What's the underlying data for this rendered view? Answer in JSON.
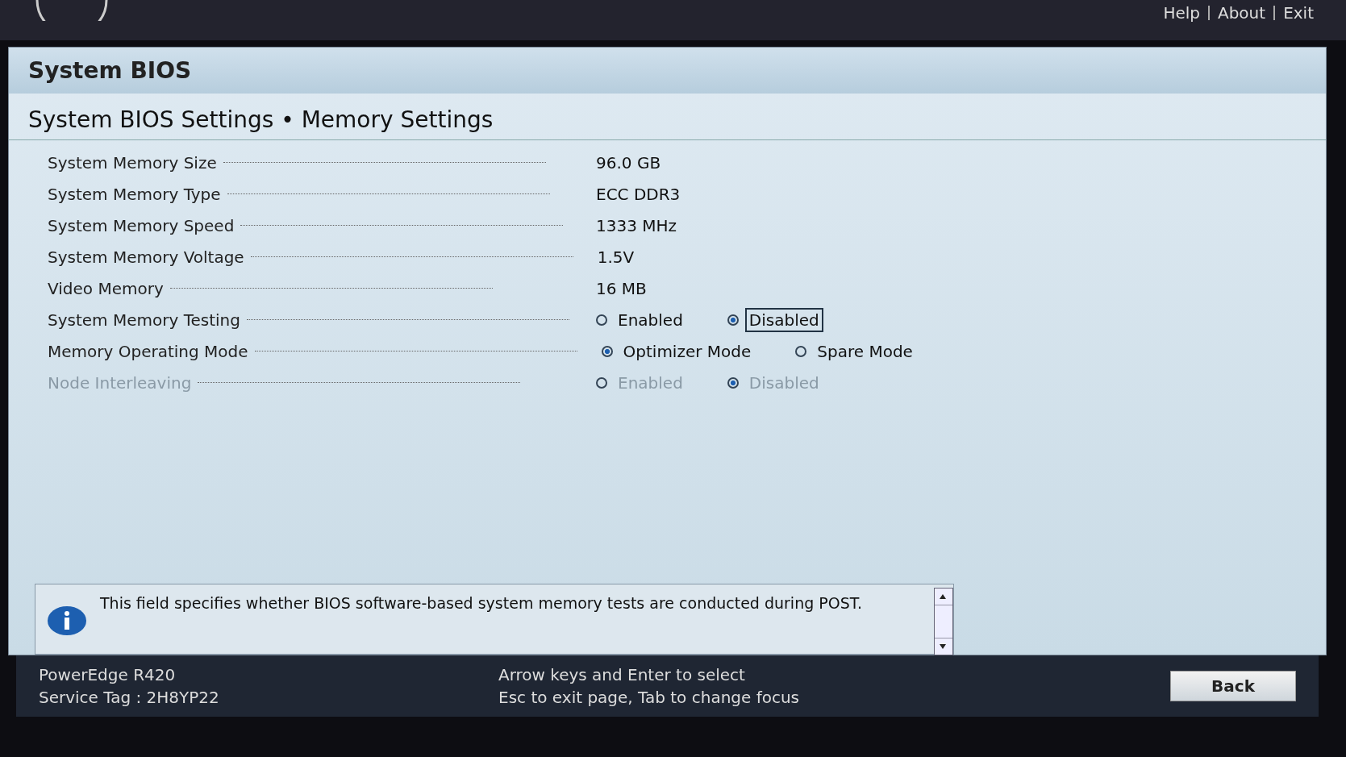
{
  "header": {
    "links": [
      "Help",
      "About",
      "Exit"
    ]
  },
  "title": "System BIOS",
  "subtitle": "System BIOS Settings • Memory Settings",
  "settings": [
    {
      "kind": "value",
      "label": "System Memory Size",
      "disabled": false,
      "value": "96.0 GB"
    },
    {
      "kind": "value",
      "label": "System Memory Type",
      "disabled": false,
      "value": "ECC DDR3"
    },
    {
      "kind": "value",
      "label": "System Memory Speed",
      "disabled": false,
      "value": "1333 MHz"
    },
    {
      "kind": "value",
      "label": "System Memory Voltage",
      "disabled": false,
      "value": "1.5V"
    },
    {
      "kind": "value",
      "label": "Video Memory",
      "disabled": false,
      "value": "16 MB"
    },
    {
      "kind": "radio",
      "label": "System Memory Testing",
      "disabled": false,
      "options": [
        {
          "label": "Enabled",
          "selected": false,
          "focused": false
        },
        {
          "label": "Disabled",
          "selected": true,
          "focused": true
        }
      ]
    },
    {
      "kind": "radio",
      "label": "Memory Operating Mode",
      "disabled": false,
      "options": [
        {
          "label": "Optimizer Mode",
          "selected": true,
          "focused": false
        },
        {
          "label": "Spare Mode",
          "selected": false,
          "focused": false
        }
      ]
    },
    {
      "kind": "radio",
      "label": "Node Interleaving",
      "disabled": true,
      "options": [
        {
          "label": "Enabled",
          "selected": false,
          "focused": false
        },
        {
          "label": "Disabled",
          "selected": true,
          "focused": false
        }
      ]
    }
  ],
  "info": "This field specifies whether BIOS software-based system memory tests are conducted during POST.",
  "footer": {
    "model": "PowerEdge R420",
    "service_tag": "Service Tag : 2H8YP22",
    "hints": [
      "Arrow keys and Enter to select",
      "Esc to exit page, Tab to change focus"
    ],
    "back": "Back"
  }
}
